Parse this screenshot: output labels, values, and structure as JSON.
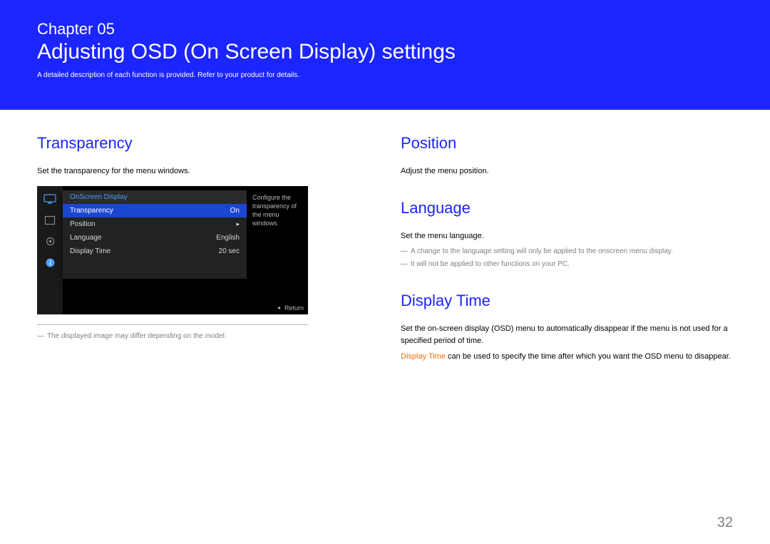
{
  "banner": {
    "chapter_label": "Chapter 05",
    "title": "Adjusting OSD (On Screen Display) settings",
    "subtitle": "A detailed description of each function is provided. Refer to your product for details."
  },
  "left": {
    "transparency_title": "Transparency",
    "transparency_text": "Set the transparency for the menu windows.",
    "image_note": "The displayed image may differ depending on the model."
  },
  "osd": {
    "header": "OnScreen Display",
    "rows": [
      {
        "label": "Transparency",
        "value": "On"
      },
      {
        "label": "Position",
        "value": ""
      },
      {
        "label": "Language",
        "value": "English"
      },
      {
        "label": "Display Time",
        "value": "20 sec"
      }
    ],
    "arrow": "▸",
    "desc": "Configure the transparency of the menu windows.",
    "return_tri": "◂",
    "return_label": "Return"
  },
  "right": {
    "position_title": "Position",
    "position_text": "Adjust the menu position.",
    "language_title": "Language",
    "language_text": "Set the menu language.",
    "language_note1": "A change to the language setting will only be applied to the onscreen menu display.",
    "language_note2": "It will not be applied to other functions on your PC.",
    "displaytime_title": "Display Time",
    "displaytime_text": "Set the on-screen display (OSD) menu to automatically disappear if the menu is not used for a specified period of time.",
    "displaytime_highlight": "Display Time",
    "displaytime_tail": " can be used to specify the time after which you want the OSD menu to disappear."
  },
  "page_number": "32"
}
